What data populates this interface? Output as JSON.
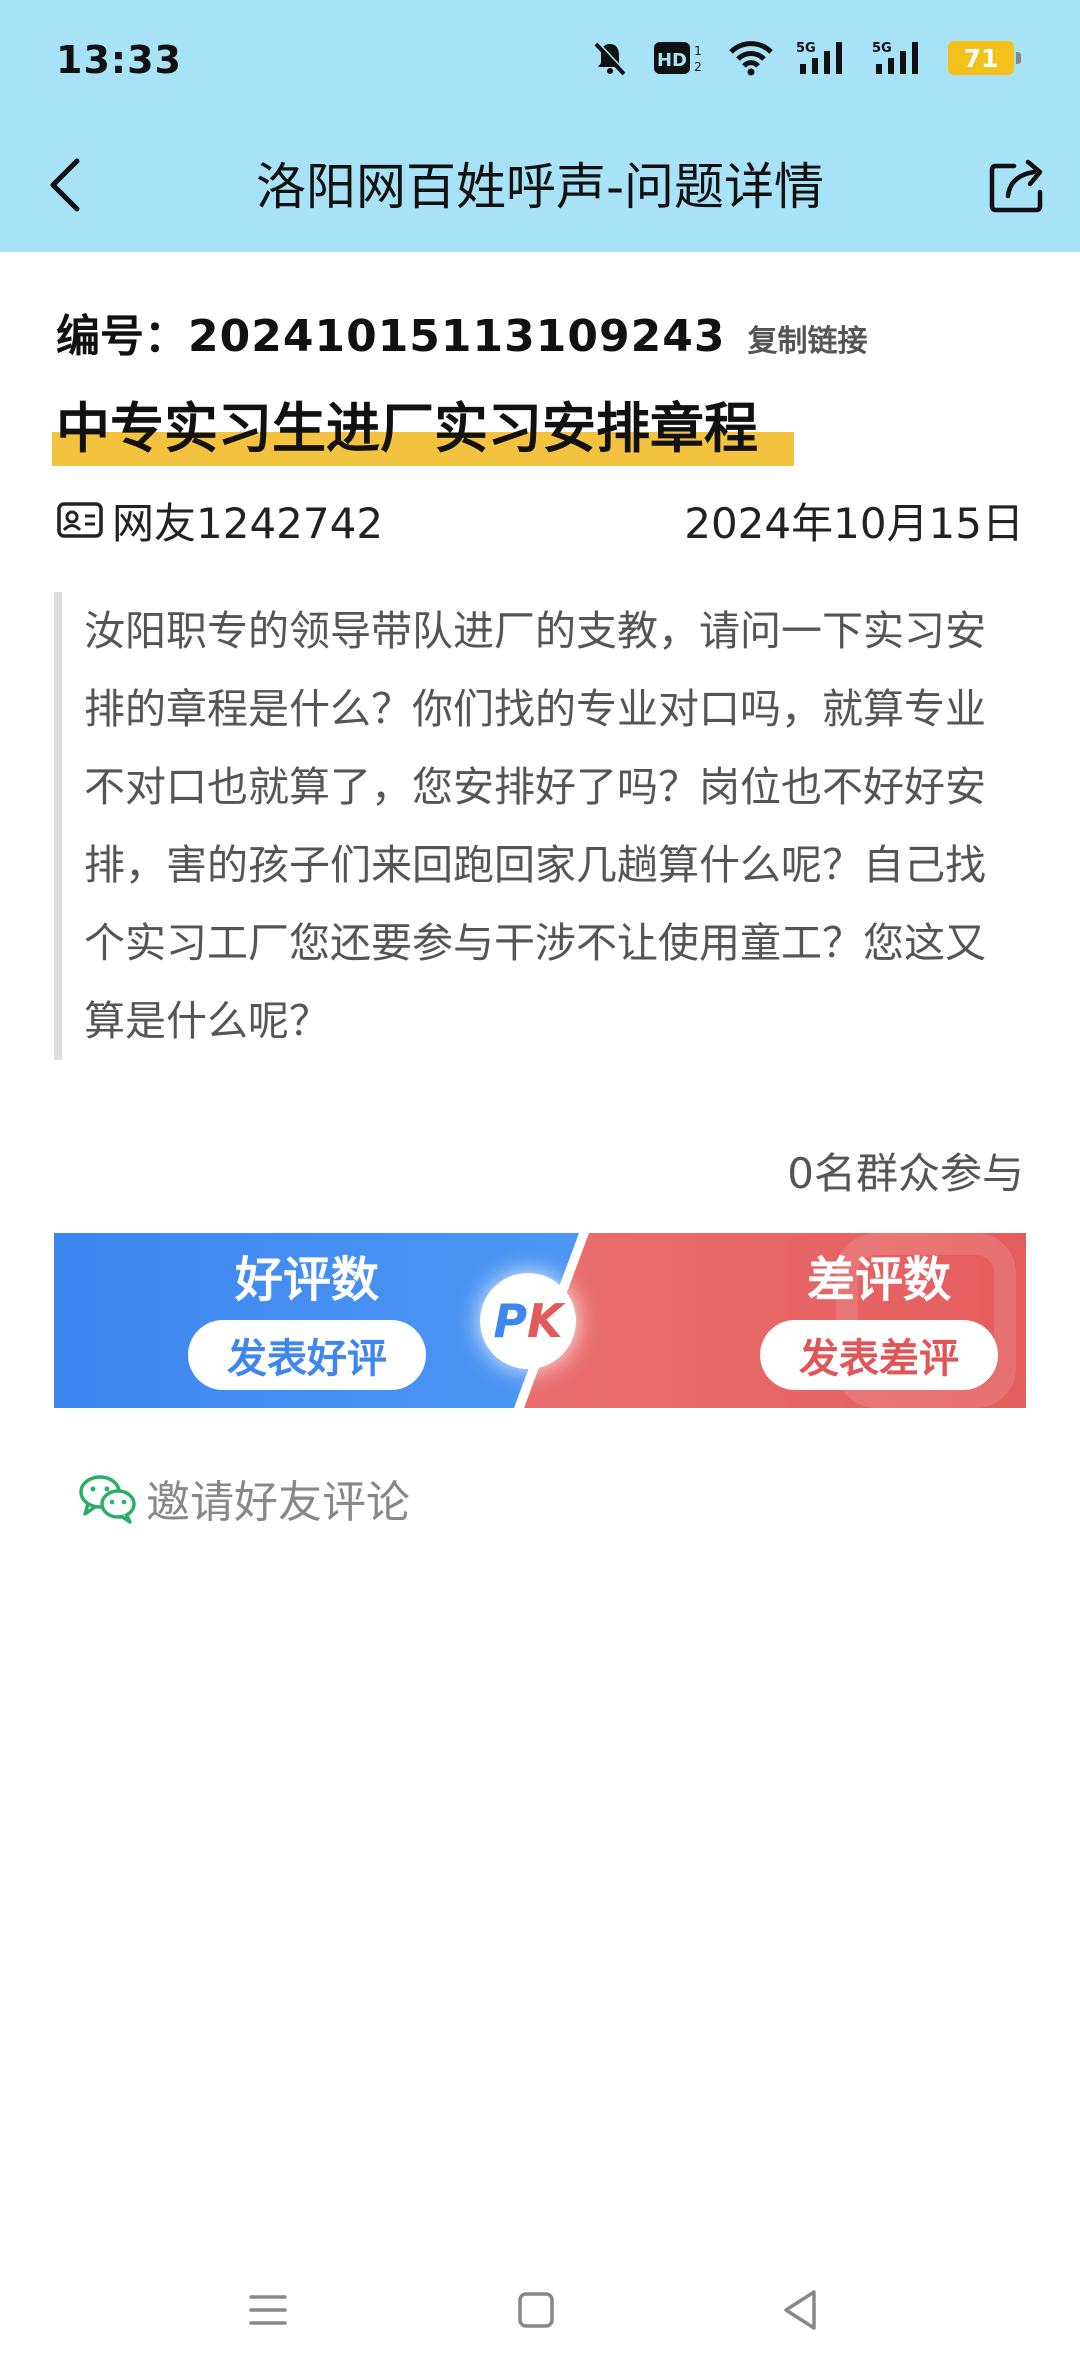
{
  "status_bar": {
    "time": "13:33",
    "battery": "71",
    "icons": [
      "bell-off-icon",
      "hd-icon",
      "wifi-icon",
      "signal-5g-icon",
      "signal-5g-icon",
      "battery-icon"
    ]
  },
  "header": {
    "title": "洛阳网百姓呼声-问题详情",
    "back_icon": "chevron-left-icon",
    "share_icon": "share-icon"
  },
  "issue": {
    "code_label": "编号：",
    "code": "20241015113109243",
    "copy_link": "复制链接",
    "title": "中专实习生进厂实习安排章程",
    "author": "网友1242742",
    "date": "2024年10月15日",
    "content": "汝阳职专的领导带队进厂的支教，请问一下实习安排的章程是什么？你们找的专业对口吗，就算专业不对口也就算了，您安排好了吗？岗位也不好好安排，害的孩子们来回跑回家几趟算什么呢？自己找个实习工厂您还要参与干涉不让使用童工？您这又算是什么呢？"
  },
  "participants": "0名群众参与",
  "pk": {
    "good_label": "好评数",
    "good_button": "发表好评",
    "bad_label": "差评数",
    "bad_button": "发表差评",
    "pk_p": "P",
    "pk_k": "K"
  },
  "invite": {
    "label": "邀请好友评论",
    "icon": "wechat-icon"
  },
  "colors": {
    "header_bg": "#a8e2f7",
    "title_highlight": "#f3c23f",
    "good_blue": "#3f86ee",
    "bad_red": "#e05656",
    "wechat_green": "#2aae67"
  },
  "nav": [
    "menu-icon",
    "home-square-icon",
    "back-triangle-icon"
  ]
}
